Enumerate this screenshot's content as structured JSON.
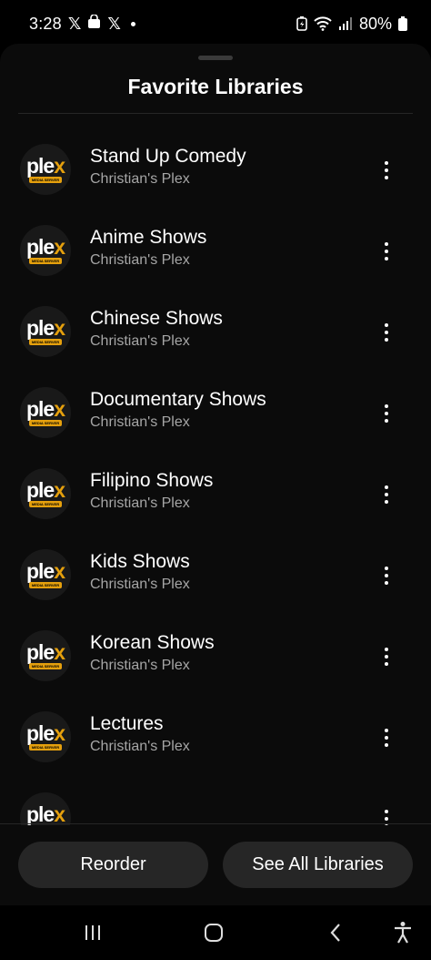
{
  "status_bar": {
    "time": "3:28",
    "notification_icons": [
      "x-icon",
      "shopping-bag-icon",
      "x-icon",
      "dot-icon"
    ],
    "battery_percent": "80%"
  },
  "sheet": {
    "title": "Favorite Libraries",
    "items": [
      {
        "title": "",
        "subtitle": "Christian's Plex"
      },
      {
        "title": "Stand Up Comedy",
        "subtitle": "Christian's Plex"
      },
      {
        "title": "Anime Shows",
        "subtitle": "Christian's Plex"
      },
      {
        "title": "Chinese Shows",
        "subtitle": "Christian's Plex"
      },
      {
        "title": "Documentary Shows",
        "subtitle": "Christian's Plex"
      },
      {
        "title": "Filipino Shows",
        "subtitle": "Christian's Plex"
      },
      {
        "title": "Kids Shows",
        "subtitle": "Christian's Plex"
      },
      {
        "title": "Korean Shows",
        "subtitle": "Christian's Plex"
      },
      {
        "title": "Lectures",
        "subtitle": "Christian's Plex"
      },
      {
        "title": "",
        "subtitle": ""
      }
    ],
    "logo": {
      "word": "ple",
      "accent": "x",
      "badge": "MEDIA SERVER"
    }
  },
  "buttons": {
    "reorder": "Reorder",
    "see_all": "See All Libraries"
  },
  "colors": {
    "plex_accent": "#e5a00d",
    "button_bg": "#262626",
    "subtitle": "#a6a6a6"
  }
}
